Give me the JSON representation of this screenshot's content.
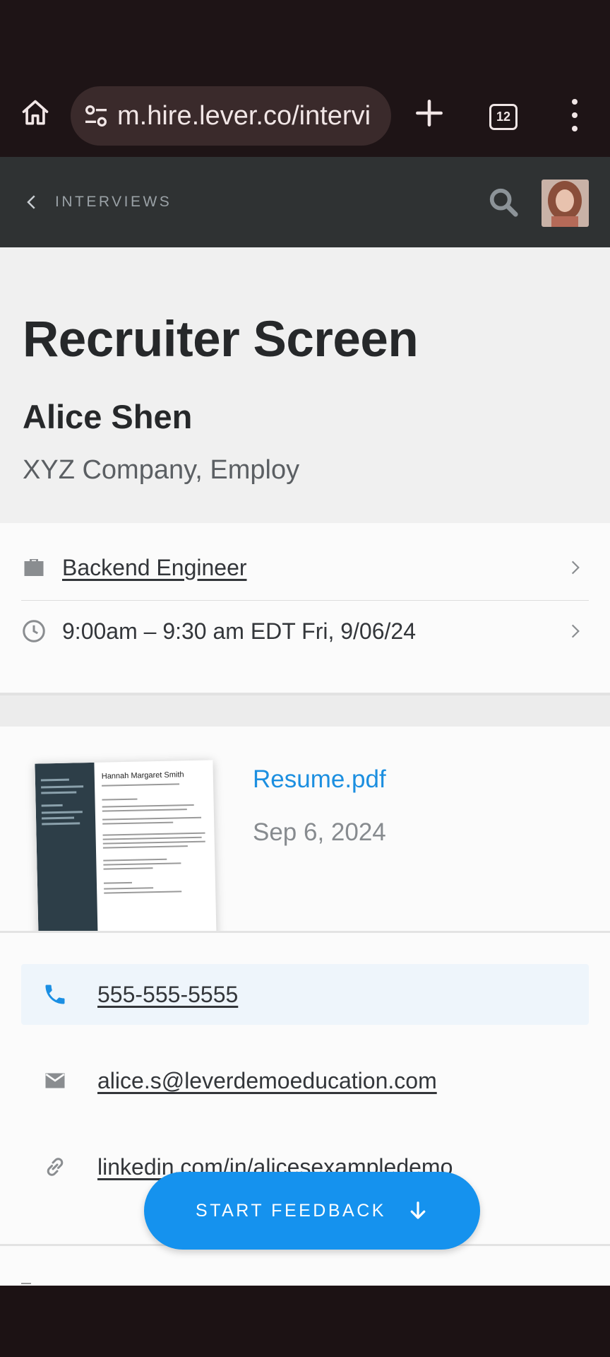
{
  "browser": {
    "url": "m.hire.lever.co/intervi",
    "tab_count": "12",
    "icons": [
      "home-icon",
      "tune-icon",
      "plus-icon",
      "tabs-icon",
      "more-vert-icon"
    ]
  },
  "header": {
    "back_label": "INTERVIEWS",
    "icons": [
      "chevron-left-icon",
      "search-icon"
    ]
  },
  "interview": {
    "title": "Recruiter Screen",
    "candidate_name": "Alice Shen",
    "company": "XYZ Company, Employ",
    "job": "Backend Engineer",
    "time": "9:00am – 9:30 am EDT Fri, 9/06/24"
  },
  "resume": {
    "file_name": "Resume.pdf",
    "date": "Sep 6, 2024",
    "thumb_name": "Hannah Margaret Smith"
  },
  "contact": {
    "phone": "555-555-5555",
    "email": "alice.s@leverdemoeducation.com",
    "linkedin": "linkedin.com/in/alicesexampledemo"
  },
  "cta": {
    "label": "START FEEDBACK"
  },
  "colors": {
    "accent": "#1592ee",
    "link": "#1c8fe0",
    "header_bg": "#2f3233",
    "browser_bg": "#1e1416"
  }
}
